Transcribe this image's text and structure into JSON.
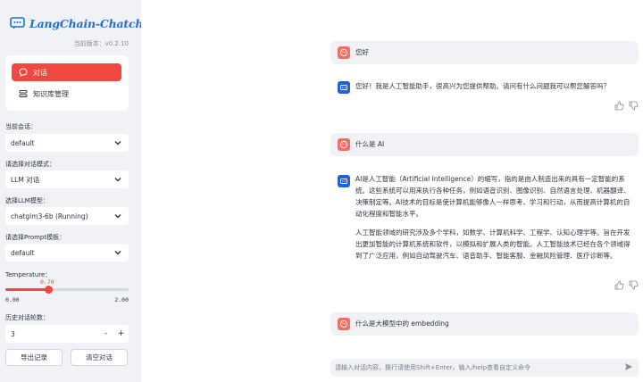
{
  "app": {
    "logo_text": "LangChain-Chatchat",
    "version_label": "当前版本：v0.2.10"
  },
  "nav": {
    "items": [
      {
        "label": "对话",
        "icon": "chat-bubble-icon",
        "active": true
      },
      {
        "label": "知识库管理",
        "icon": "database-icon",
        "active": false
      }
    ]
  },
  "sidebar": {
    "conversation": {
      "label": "当前会话：",
      "value": "default"
    },
    "mode": {
      "label": "请选择对话模式：",
      "value": "LLM 对话"
    },
    "model": {
      "label": "选择LLM模型：",
      "value": "chatglm3-6b (Running)"
    },
    "prompt": {
      "label": "请选择Prompt模板：",
      "value": "default"
    },
    "temperature": {
      "label": "Temperature：",
      "value": "0.70",
      "min": "0.00",
      "max": "2.00",
      "fraction": 0.35
    },
    "history": {
      "label": "历史对话轮数：",
      "value": "3",
      "minus": "-",
      "plus": "+"
    },
    "export_label": "导出记录",
    "clear_label": "清空对话"
  },
  "chat": {
    "messages": [
      {
        "role": "user",
        "text": "您好"
      },
      {
        "role": "assistant",
        "text": "您好！我是人工智能助手，很高兴为您提供帮助。请问有什么问题我可以帮您解答吗？"
      },
      {
        "role": "user",
        "text": "什么是 AI"
      },
      {
        "role": "assistant",
        "paragraphs": [
          "AI是人工智能（Artificial Intelligence）的缩写，指的是由人制造出来的具有一定智能的系统。这些系统可以用来执行各种任务，例如语音识别、图像识别、自然语言处理、机器翻译、决策制定等。AI技术的目标是使计算机能够像人一样思考、学习和行动，从而提高计算机的自动化程度和智能水平。",
          "人工智能领域的研究涉及多个学科，如数学、计算机科学、工程学、认知心理学等。旨在开发出更加智能的计算机系统和软件，以模拟和扩展人类的智能。人工智能技术已经在各个领域得到了广泛应用，例如自动驾驶汽车、语音助手、智能客服、金融风险管理、医疗诊断等。"
        ]
      },
      {
        "role": "user",
        "text": "什么是大模型中的 embedding"
      }
    ],
    "input_placeholder": "请输入对话内容，换行请使用Shift+Enter。输入/help查看自定义命令"
  },
  "colors": {
    "accent": "#f0483e",
    "brand": "#1f6fd6",
    "bot_avatar": "#1f5fe0",
    "user_avatar": "#f86b62",
    "sidebar_bg": "#f0f2f6"
  }
}
